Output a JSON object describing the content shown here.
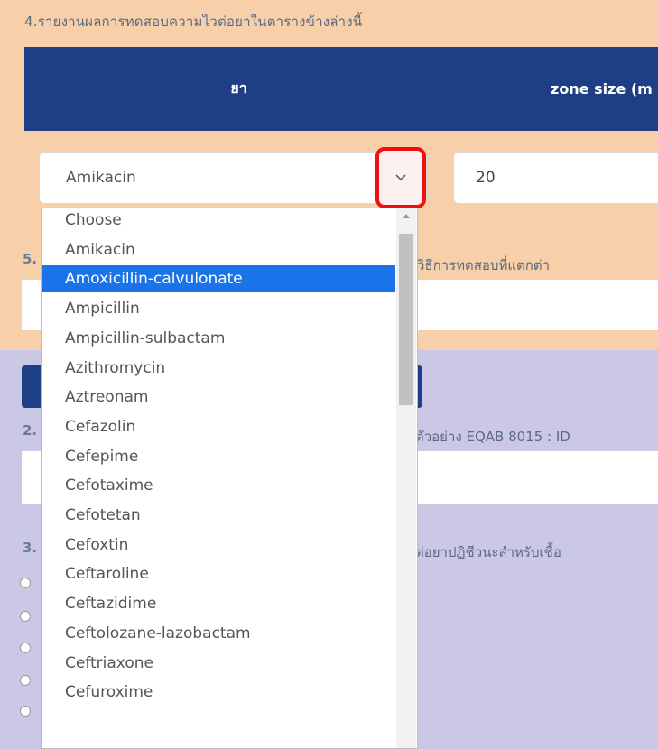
{
  "section4": {
    "title": "4.รายงานผลการทดสอบความไวต่อยาในตารางข้างล่างนี้",
    "col_drug": "ยา",
    "col_zone": "zone size (m",
    "drug_select_value": "Amikacin",
    "zone_value": "20"
  },
  "section5": {
    "number": "5.",
    "text": "วิธีการทดสอบที่แตกต่า"
  },
  "section2": {
    "number": "2.",
    "text": "ตัวอย่าง EQAB 8015 : ID"
  },
  "section3": {
    "number": "3.",
    "text": "ต่อยาปฏิชีวนะสำหรับเชื้อ"
  },
  "dropdown": {
    "selected_index": 2,
    "options": [
      "Choose",
      "Amikacin",
      "Amoxicillin-calvulonate",
      "Ampicillin",
      "Ampicillin-sulbactam",
      "Azithromycin",
      "Aztreonam",
      "Cefazolin",
      "Cefepime",
      "Cefotaxime",
      "Cefotetan",
      "Cefoxtin",
      "Ceftaroline",
      "Ceftazidime",
      "Ceftolozane-lazobactam",
      "Ceftriaxone",
      "Cefuroxime"
    ]
  },
  "colors": {
    "peach": "#f7cfa8",
    "navy": "#1e3e86",
    "lavender": "#cbc8e6",
    "highlight": "#1a73e8",
    "annotation_red": "#e11111"
  }
}
